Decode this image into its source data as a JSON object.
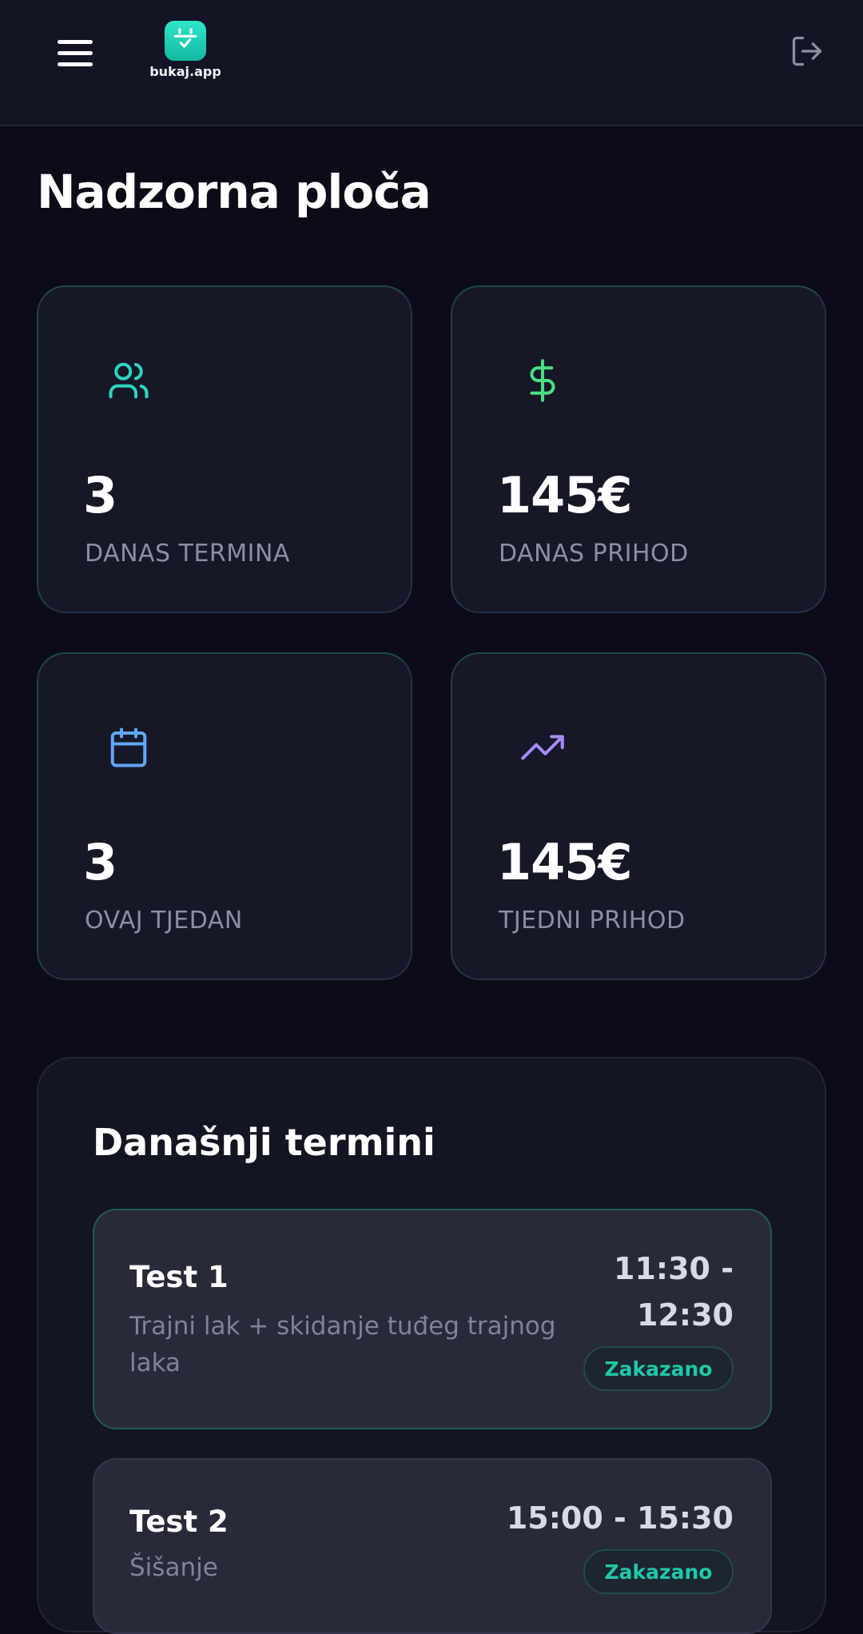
{
  "header": {
    "menu_icon": "hamburger-menu-icon",
    "logo_text": "bukaj.app",
    "logo_icon": "calendar-check-icon",
    "logout_icon": "logout-icon",
    "accent_color": "#21c7a8"
  },
  "page": {
    "title": "Nadzorna ploča"
  },
  "stats": [
    {
      "icon": "users-icon",
      "icon_color": "#2dd4bf",
      "value": "3",
      "label": "DANAS TERMINA"
    },
    {
      "icon": "dollar-icon",
      "icon_color": "#4ade80",
      "value": "145€",
      "label": "DANAS PRIHOD"
    },
    {
      "icon": "calendar-icon",
      "icon_color": "#60a5fa",
      "value": "3",
      "label": "OVAJ TJEDAN"
    },
    {
      "icon": "trending-up-icon",
      "icon_color": "#a78bfa",
      "value": "145€",
      "label": "TJEDNI PRIHOD"
    }
  ],
  "today": {
    "title": "Današnji termini",
    "appointments": [
      {
        "name": "Test 1",
        "service": "Trajni lak + skidanje tuđeg trajnog laka",
        "time_start": "11:30 -",
        "time_end": "12:30",
        "status": "Zakazano"
      },
      {
        "name": "Test 2",
        "service": "Šišanje",
        "time": "15:00 - 15:30",
        "status": "Zakazano"
      }
    ]
  }
}
